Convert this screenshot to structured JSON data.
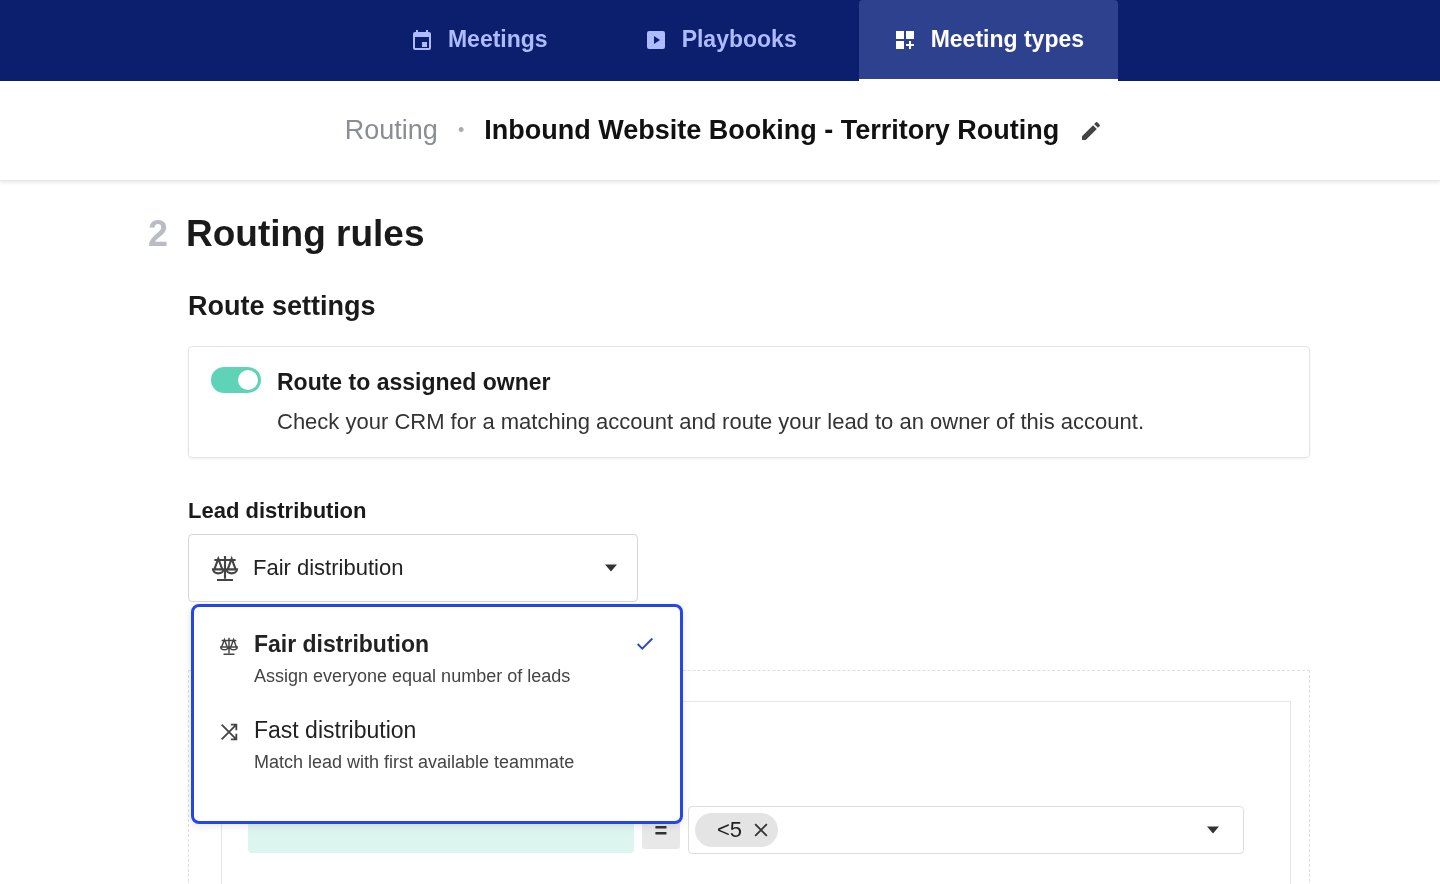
{
  "nav": {
    "tabs": [
      {
        "label": "Meetings",
        "selected": false
      },
      {
        "label": "Playbooks",
        "selected": false
      },
      {
        "label": "Meeting types",
        "selected": true
      }
    ]
  },
  "breadcrumb": {
    "parent": "Routing",
    "separator": "•",
    "title": "Inbound Website Booking - Territory Routing"
  },
  "section": {
    "number": "2",
    "title": "Routing rules"
  },
  "route_settings": {
    "title": "Route settings",
    "option": {
      "label": "Route to assigned owner",
      "description": "Check your CRM for a matching account and route your lead to an owner of this account.",
      "on": true
    }
  },
  "lead_distribution": {
    "label": "Lead distribution",
    "value": "Fair distribution",
    "options": [
      {
        "label": "Fair distribution",
        "description": "Assign everyone equal number of leads",
        "selected": true
      },
      {
        "label": "Fast distribution",
        "description": "Match lead with first available teammate",
        "selected": false
      }
    ]
  },
  "condition": {
    "operator": "=",
    "values": [
      "<5"
    ]
  }
}
